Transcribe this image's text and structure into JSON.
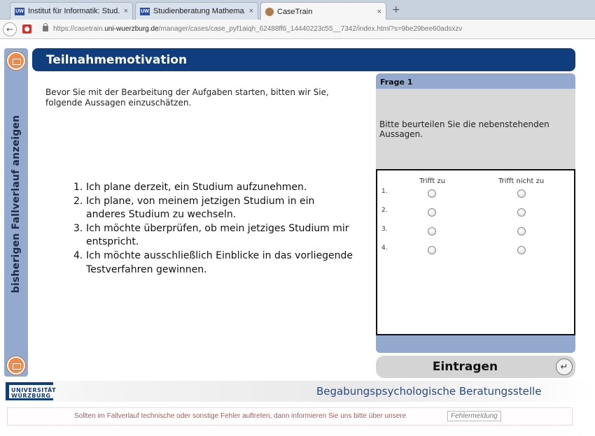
{
  "browser": {
    "tabs": [
      {
        "label": "Institut für Informatik: Stud...",
        "favicon": "UW",
        "close": "×",
        "active": false
      },
      {
        "label": "Studienberatung Mathema...",
        "favicon": "UW",
        "close": "×",
        "active": false
      },
      {
        "label": "CaseTrain",
        "favicon": "cat-icon",
        "close": "×",
        "active": true
      }
    ],
    "new_tab": "+",
    "url_prefix": "https://casetrain.",
    "url_domain": "uni-wuerzburg.de",
    "url_path": "/manager/cases/case_pyf1aiqh_62488ff6_14440223c55__7342/index.html?s=9be29bee60adsxzv"
  },
  "sidebar": {
    "label": "bisherigen Fallverlauf anzeigen",
    "accent": "#f08a4b",
    "color": "#93a9cd"
  },
  "header": {
    "title": "Teilnahmemotivation",
    "color": "#0f3d7d"
  },
  "intro": "Bevor Sie mit der Bearbeitung der Aufgaben starten, bitten wir Sie, folgende Aussagen einzuschätzen.",
  "statements": [
    {
      "num": "1.",
      "text": "Ich plane derzeit, ein Studium aufzunehmen."
    },
    {
      "num": "2.",
      "text": "Ich plane, von meinem jetzigen Studium in ein anderes Studium zu wechseln."
    },
    {
      "num": "3.",
      "text": "Ich möchte überprüfen, ob mein jetziges Studium mir entspricht."
    },
    {
      "num": "4.",
      "text": "Ich möchte ausschließlich Einblicke in das vorliegende Testverfahren gewinnen."
    }
  ],
  "question": {
    "title": "Frage 1",
    "prompt": "Bitte beurteilen Sie die nebenstehenden Aussagen.",
    "columns": [
      "Trifft zu",
      "Trifft nicht zu"
    ],
    "rows": [
      "1.",
      "2.",
      "3.",
      "4."
    ]
  },
  "submit_label": "Eintragen",
  "footer": {
    "logo_line1": "UNIVERSITÄT",
    "logo_line2": "WÜRZBURG",
    "department": "Begabungspsychologische Beratungsstelle",
    "notice": "Sollten im Fallverlauf technische oder sonstige Fehler auftreten, dann informieren Sie uns bitte über unsere",
    "notice_link": "Fehlermeldung"
  }
}
